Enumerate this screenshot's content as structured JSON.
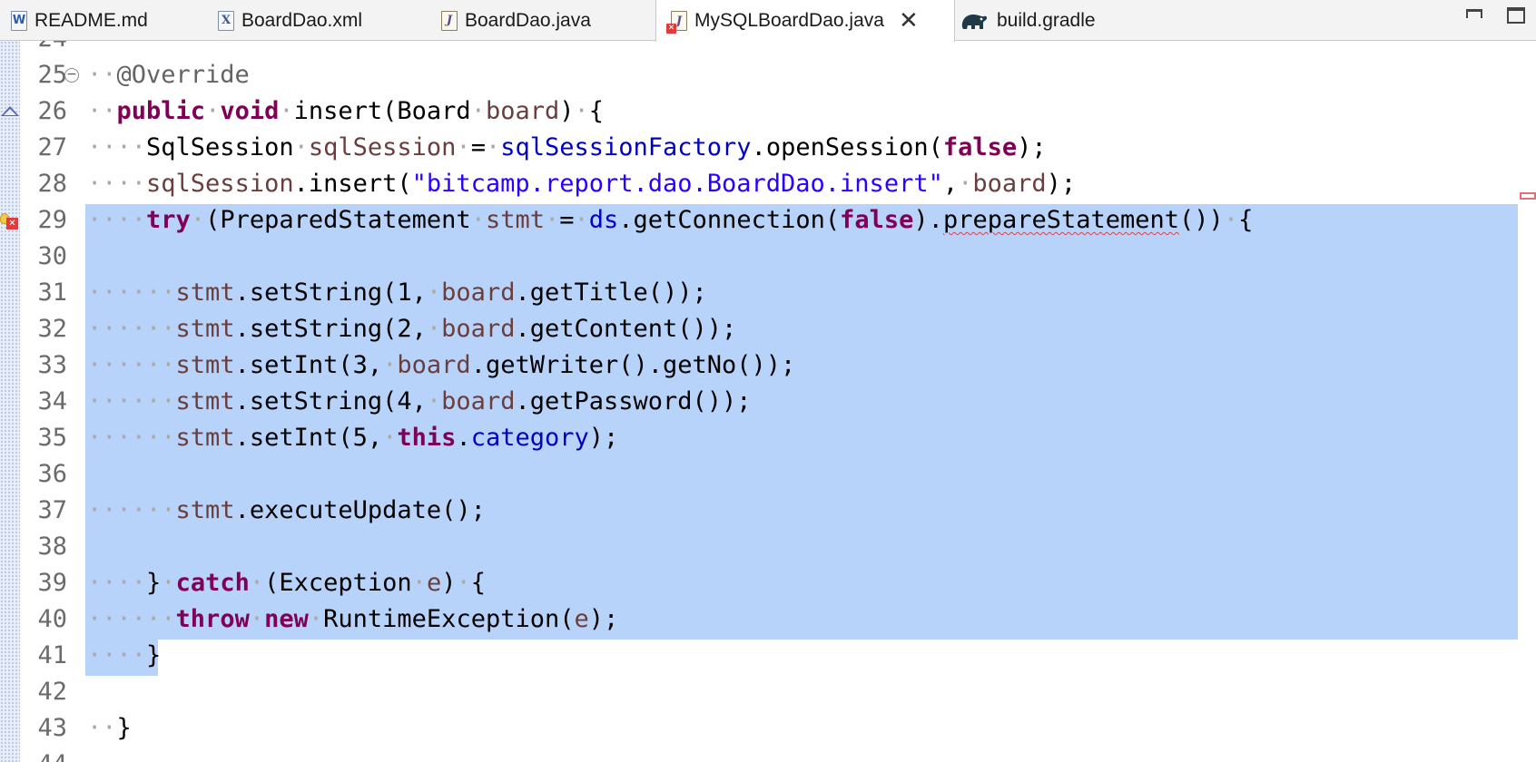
{
  "tabs": [
    {
      "label": "README.md",
      "icon": "word-doc-icon",
      "active": false
    },
    {
      "label": "BoardDao.xml",
      "icon": "xml-file-icon",
      "active": false
    },
    {
      "label": "BoardDao.java",
      "icon": "java-file-icon",
      "active": false
    },
    {
      "label": "MySQLBoardDao.java",
      "icon": "java-file-error-icon",
      "active": true
    },
    {
      "label": "build.gradle",
      "icon": "gradle-elephant-icon",
      "active": false
    }
  ],
  "editor": {
    "lines": [
      {
        "n": "24",
        "text": "",
        "partial": true
      },
      {
        "n": "25",
        "text": "@Override"
      },
      {
        "n": "26",
        "text": "public void insert(Board board) {"
      },
      {
        "n": "27",
        "text": "SqlSession sqlSession = sqlSessionFactory.openSession(false);"
      },
      {
        "n": "28",
        "text": "sqlSession.insert(\"bitcamp.report.dao.BoardDao.insert\", board);"
      },
      {
        "n": "29",
        "text": "try (PreparedStatement stmt = ds.getConnection(false).prepareStatement()) {"
      },
      {
        "n": "30",
        "text": ""
      },
      {
        "n": "31",
        "text": "stmt.setString(1, board.getTitle());"
      },
      {
        "n": "32",
        "text": "stmt.setString(2, board.getContent());"
      },
      {
        "n": "33",
        "text": "stmt.setInt(3, board.getWriter().getNo());"
      },
      {
        "n": "34",
        "text": "stmt.setString(4, board.getPassword());"
      },
      {
        "n": "35",
        "text": "stmt.setInt(5, this.category);"
      },
      {
        "n": "36",
        "text": ""
      },
      {
        "n": "37",
        "text": "stmt.executeUpdate();"
      },
      {
        "n": "38",
        "text": ""
      },
      {
        "n": "39",
        "text": "} catch (Exception e) {"
      },
      {
        "n": "40",
        "text": "throw new RuntimeException(e);"
      },
      {
        "n": "41",
        "text": "}"
      },
      {
        "n": "42",
        "text": ""
      },
      {
        "n": "43",
        "text": "}"
      },
      {
        "n": "44",
        "text": "",
        "partial": true
      }
    ],
    "selection": {
      "from_line": "29",
      "to_line": "41"
    },
    "colors": {
      "keyword": "#7f0055",
      "annotation": "#646464",
      "local_variable": "#6a3e3e",
      "field": "#0000c0",
      "string": "#2a00ff",
      "selection": "#b8d3f9",
      "line_number": "#6b6b6b"
    }
  }
}
